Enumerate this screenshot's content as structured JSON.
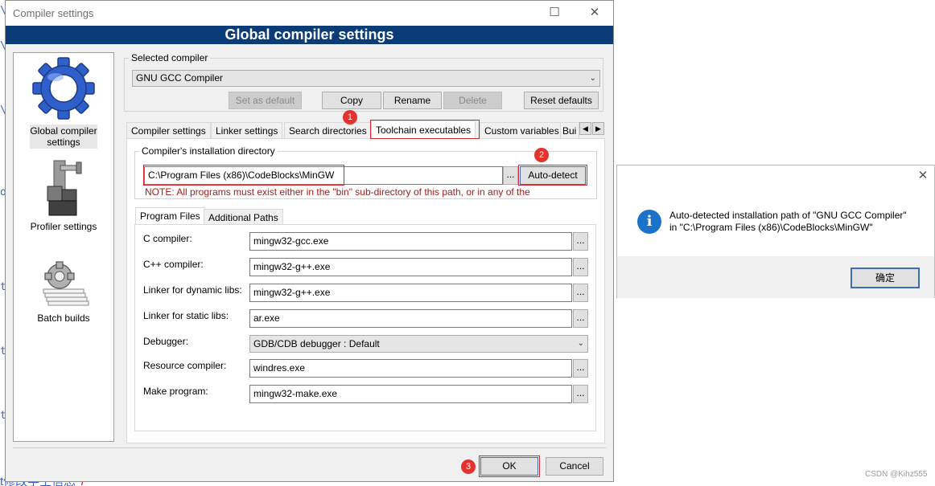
{
  "background": {
    "fragments": [
      "\\",
      "\\",
      "\\",
      "o",
      "t",
      "t",
      "t"
    ],
    "bottom_text": "t修改学生信息",
    "bottom_mark": "7"
  },
  "dialog": {
    "title": "Compiler settings",
    "banner": "Global compiler settings",
    "titlebar_buttons": {
      "minimize": "—",
      "maximize": "☐",
      "close": "✕"
    },
    "left_panel": [
      {
        "label": "Global compiler settings",
        "selected": true,
        "icon": "gear-icon"
      },
      {
        "label": "Profiler settings",
        "selected": false,
        "icon": "profiler-icon"
      },
      {
        "label": "Batch builds",
        "selected": false,
        "icon": "batch-build-icon"
      }
    ],
    "selected_compiler": {
      "group_label": "Selected compiler",
      "value": "GNU GCC Compiler",
      "buttons": {
        "set_default": "Set as default",
        "copy": "Copy",
        "rename": "Rename",
        "delete": "Delete",
        "reset": "Reset defaults"
      }
    },
    "tabs": [
      "Compiler settings",
      "Linker settings",
      "Search directories",
      "Toolchain executables",
      "Custom variables",
      "Bui"
    ],
    "active_tab": "Toolchain executables",
    "install_dir": {
      "group_label": "Compiler's installation directory",
      "value": "C:\\Program Files (x86)\\CodeBlocks\\MinGW",
      "browse": "...",
      "auto_detect": "Auto-detect",
      "note": "NOTE: All programs must exist either in the \"bin\" sub-directory of this path, or in any of the"
    },
    "sub_tabs": [
      "Program Files",
      "Additional Paths"
    ],
    "programs": [
      {
        "label": "C compiler:",
        "value": "mingw32-gcc.exe"
      },
      {
        "label": "C++ compiler:",
        "value": "mingw32-g++.exe"
      },
      {
        "label": "Linker for dynamic libs:",
        "value": "mingw32-g++.exe"
      },
      {
        "label": "Linker for static libs:",
        "value": "ar.exe"
      },
      {
        "label": "Debugger:",
        "value": "GDB/CDB debugger : Default"
      },
      {
        "label": "Resource compiler:",
        "value": "windres.exe"
      },
      {
        "label": "Make program:",
        "value": "mingw32-make.exe"
      }
    ],
    "footer": {
      "ok": "OK",
      "cancel": "Cancel"
    },
    "badges": [
      "1",
      "2",
      "3"
    ]
  },
  "message_box": {
    "close": "✕",
    "icon": "i",
    "line1": "Auto-detected installation path of \"GNU GCC Compiler\"",
    "line2": "in \"C:\\Program Files (x86)\\CodeBlocks\\MinGW\"",
    "ok": "确定"
  },
  "watermark": "CSDN @Kihz555",
  "colors": {
    "banner": "#0c3c78",
    "annotation_red": "#d9262c",
    "info_blue": "#1a73c8"
  }
}
